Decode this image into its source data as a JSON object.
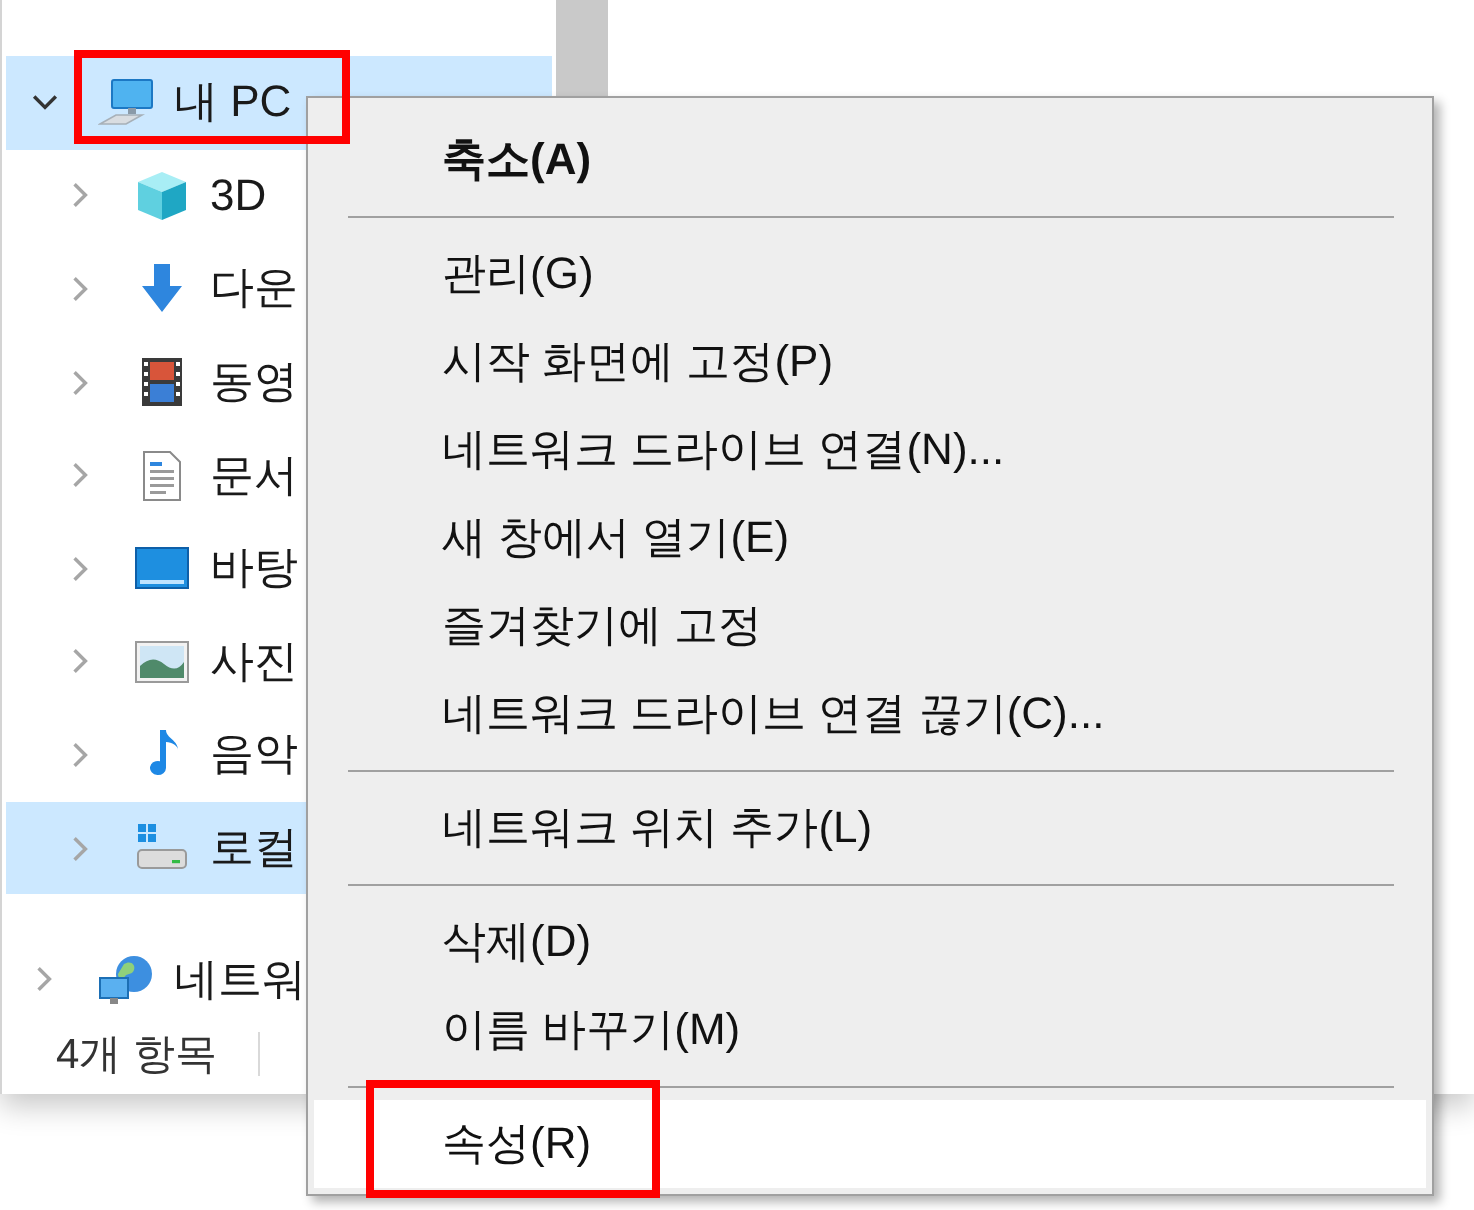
{
  "navigation": {
    "tree": [
      {
        "kind": "pc",
        "label": "내 PC",
        "expanded": true,
        "selected": true,
        "annotated": true,
        "children": [
          {
            "kind": "objects3d",
            "label": "3D",
            "expanded": false,
            "selected": false,
            "annotated": false
          },
          {
            "kind": "downloads",
            "label": "다운",
            "expanded": false,
            "selected": false,
            "annotated": false
          },
          {
            "kind": "videos",
            "label": "동영",
            "expanded": false,
            "selected": false,
            "annotated": false
          },
          {
            "kind": "documents",
            "label": "문서",
            "expanded": false,
            "selected": false,
            "annotated": false
          },
          {
            "kind": "desktop",
            "label": "바탕",
            "expanded": false,
            "selected": false,
            "annotated": false
          },
          {
            "kind": "pictures",
            "label": "사진",
            "expanded": false,
            "selected": false,
            "annotated": false
          },
          {
            "kind": "music",
            "label": "음악",
            "expanded": false,
            "selected": false,
            "annotated": false
          },
          {
            "kind": "drive",
            "label": "로컬",
            "expanded": false,
            "selected": true,
            "annotated": false
          }
        ]
      },
      {
        "kind": "network",
        "label": "네트워",
        "expanded": false,
        "selected": false,
        "annotated": false
      }
    ]
  },
  "status_bar": {
    "item_count": "4개 항목"
  },
  "context_menu": {
    "items": [
      {
        "kind": "command",
        "label": "축소(A)",
        "default": true,
        "hovered": false,
        "annotated": false
      },
      {
        "kind": "separator"
      },
      {
        "kind": "command",
        "label": "관리(G)",
        "default": false,
        "hovered": false,
        "annotated": false
      },
      {
        "kind": "command",
        "label": "시작 화면에 고정(P)",
        "default": false,
        "hovered": false,
        "annotated": false
      },
      {
        "kind": "command",
        "label": "네트워크 드라이브 연결(N)...",
        "default": false,
        "hovered": false,
        "annotated": false
      },
      {
        "kind": "command",
        "label": "새 창에서 열기(E)",
        "default": false,
        "hovered": false,
        "annotated": false
      },
      {
        "kind": "command",
        "label": "즐겨찾기에 고정",
        "default": false,
        "hovered": false,
        "annotated": false
      },
      {
        "kind": "command",
        "label": "네트워크 드라이브 연결 끊기(C)...",
        "default": false,
        "hovered": false,
        "annotated": false
      },
      {
        "kind": "separator"
      },
      {
        "kind": "command",
        "label": "네트워크 위치 추가(L)",
        "default": false,
        "hovered": false,
        "annotated": false
      },
      {
        "kind": "separator"
      },
      {
        "kind": "command",
        "label": "삭제(D)",
        "default": false,
        "hovered": false,
        "annotated": false
      },
      {
        "kind": "command",
        "label": "이름 바꾸기(M)",
        "default": false,
        "hovered": false,
        "annotated": false
      },
      {
        "kind": "separator"
      },
      {
        "kind": "command",
        "label": "속성(R)",
        "default": false,
        "hovered": true,
        "annotated": true
      }
    ]
  }
}
